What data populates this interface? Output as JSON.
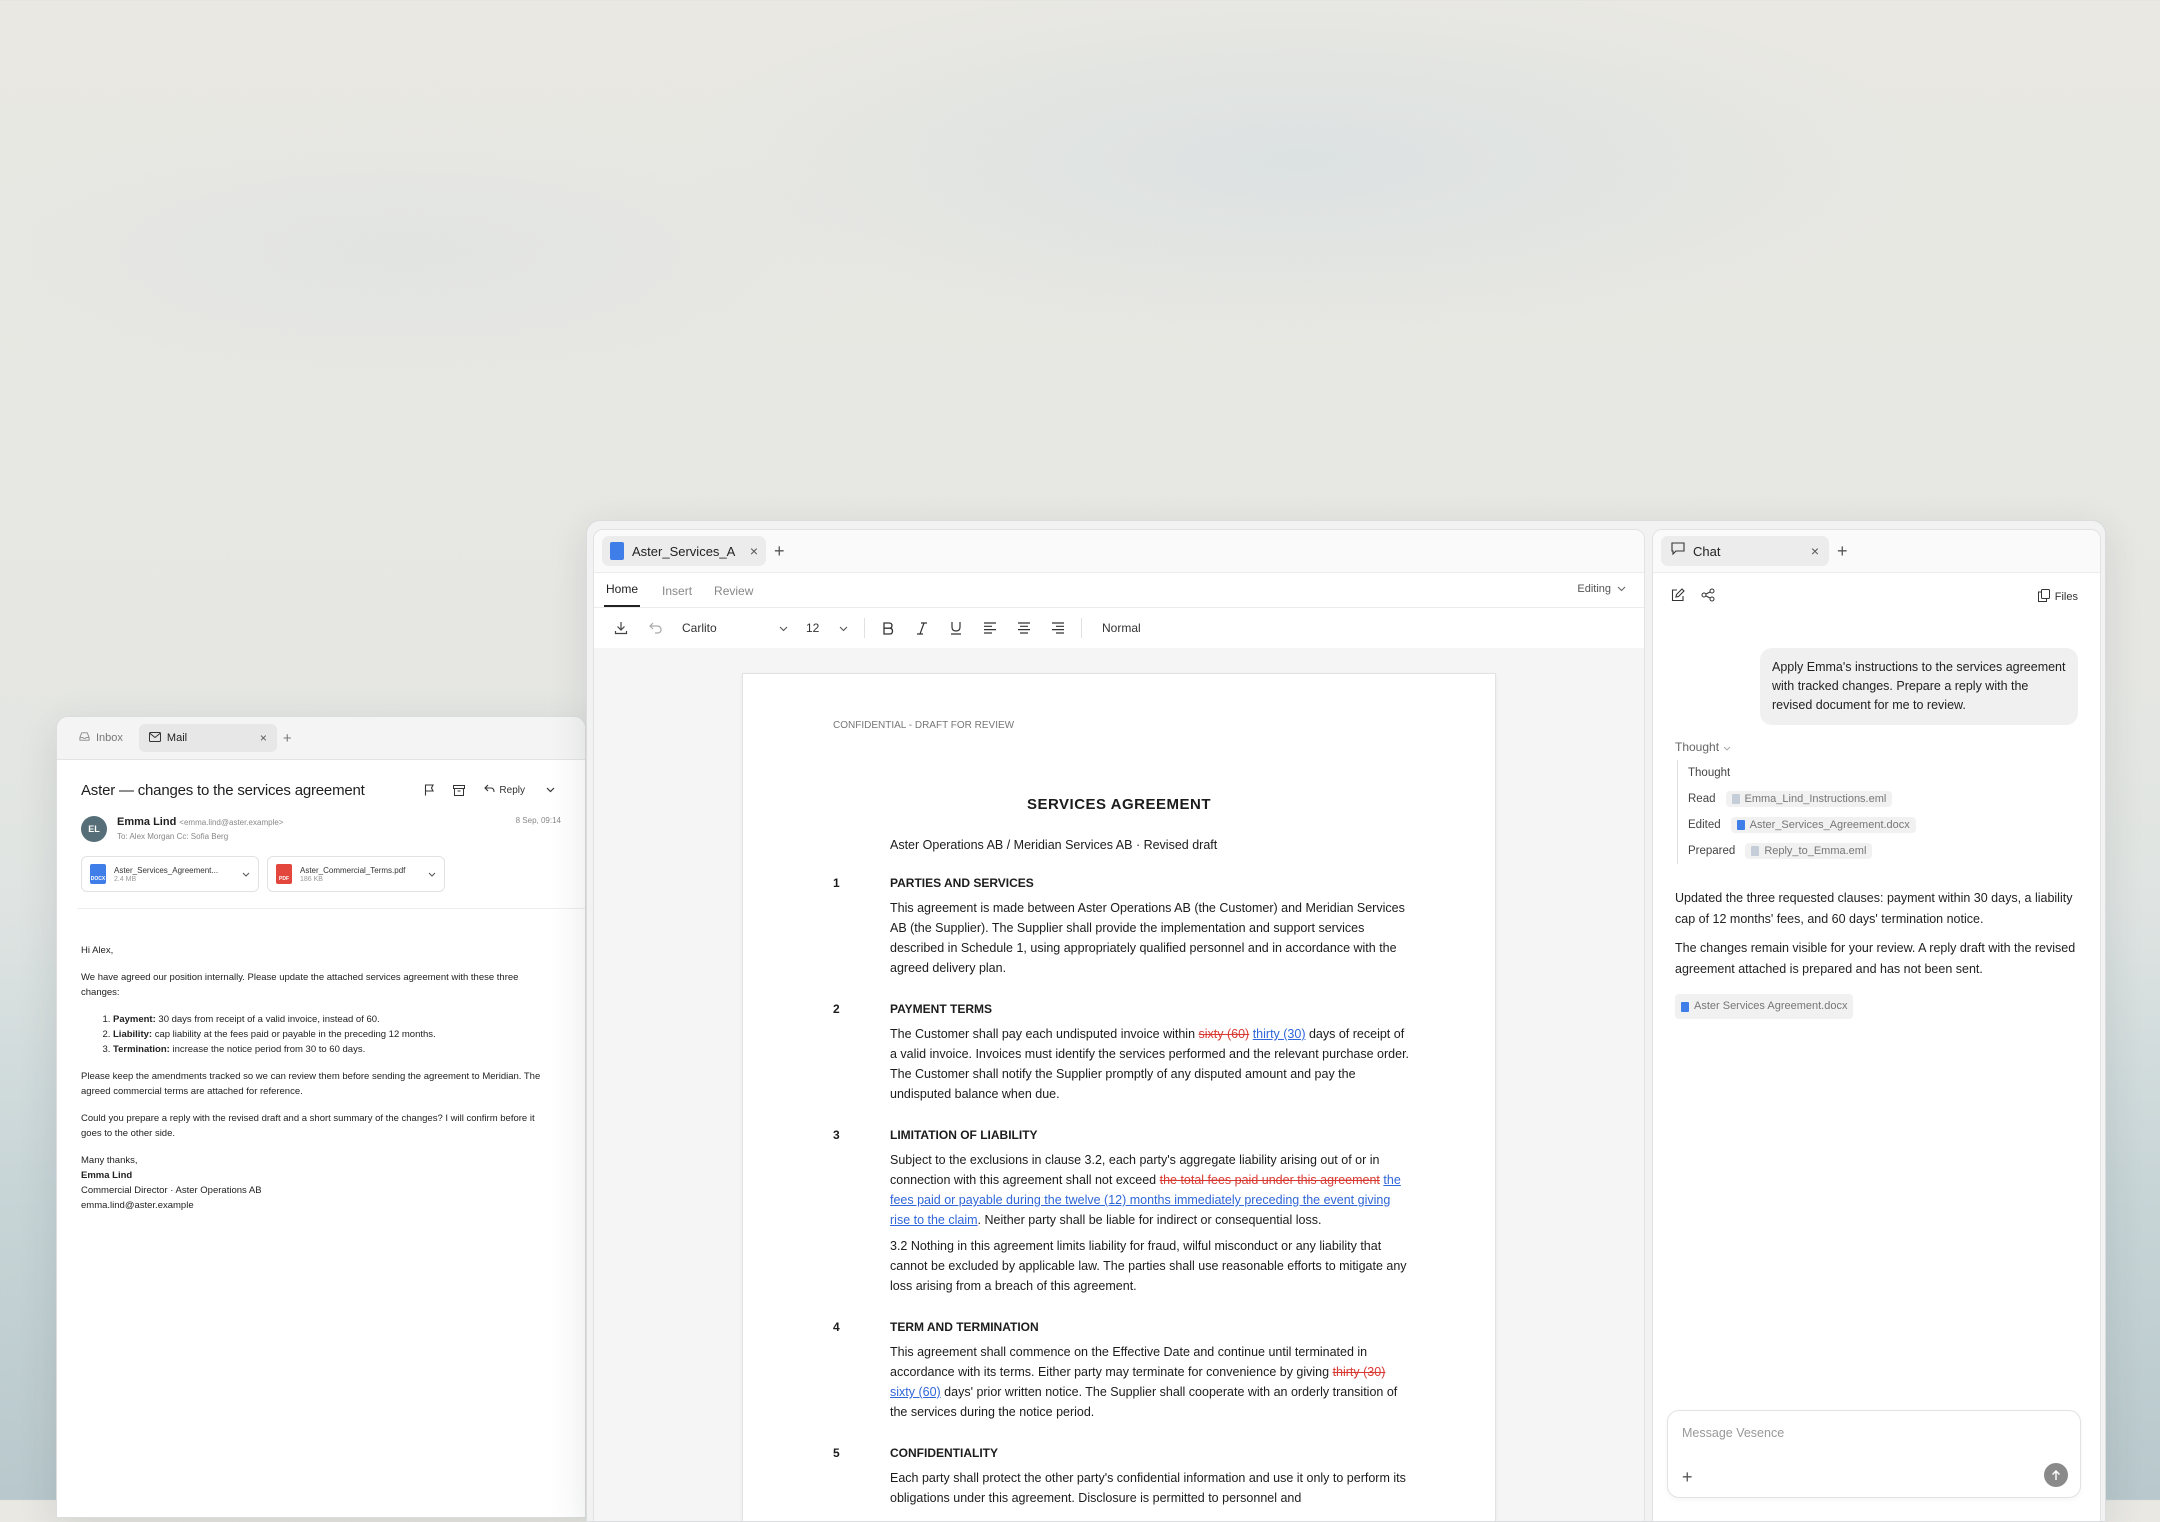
{
  "mail": {
    "tabs": [
      {
        "label": "Inbox"
      },
      {
        "label": "Mail"
      }
    ],
    "subject": "Aster — changes to the services agreement",
    "reply_label": "Reply",
    "avatar_initials": "EL",
    "sender_name": "Emma Lind",
    "sender_email": "<emma.lind@aster.example>",
    "to_line": "To: Alex Morgan   Cc: Sofia Berg",
    "date": "8 Sep, 09:14",
    "attachments": [
      {
        "name": "Aster_Services_Agreement...",
        "size": "2.4 MB",
        "type": "DOCX"
      },
      {
        "name": "Aster_Commercial_Terms.pdf",
        "size": "186 KB",
        "type": "PDF"
      }
    ],
    "greeting": "Hi Alex,",
    "para1": "We have agreed our position internally. Please update the attached services agreement with these three changes:",
    "list": [
      {
        "label": "Payment:",
        "text": "30 days from receipt of a valid invoice, instead of 60."
      },
      {
        "label": "Liability:",
        "text": "cap liability at the fees paid or payable in the preceding 12 months."
      },
      {
        "label": "Termination:",
        "text": "increase the notice period from 30 to 60 days."
      }
    ],
    "para2": "Please keep the amendments tracked so we can review them before sending the agreement to Meridian. The agreed commercial terms are attached for reference.",
    "para3": "Could you prepare a reply with the revised draft and a short summary of the changes? I will confirm before it goes to the other side.",
    "sign_off": "Many thanks,",
    "sig_name": "Emma Lind",
    "sig_title": "Commercial Director · Aster Operations AB",
    "sig_email": "emma.lind@aster.example"
  },
  "doc": {
    "tab_label": "Aster_Services_A",
    "ribbon_tabs": [
      "Home",
      "Insert",
      "Review"
    ],
    "mode": "Editing",
    "font": "Carlito",
    "size": "12",
    "style": "Normal",
    "header": "CONFIDENTIAL - DRAFT FOR REVIEW",
    "title": "SERVICES AGREEMENT",
    "subtitle": "Aster Operations AB / Meridian Services AB · Revised draft",
    "clauses": [
      {
        "num": "1",
        "heading": "PARTIES AND SERVICES",
        "body": "This agreement is made between Aster Operations AB (the Customer) and Meridian Services AB (the Supplier). The Supplier shall provide the implementation and support services described in Schedule 1, using appropriately qualified personnel and in accordance with the agreed delivery plan."
      },
      {
        "num": "2",
        "heading": "PAYMENT TERMS",
        "pre": "The Customer shall pay each undisputed invoice within ",
        "del": "sixty (60)",
        "ins": "thirty (30)",
        "post": " days of receipt of a valid invoice. Invoices must identify the services performed and the relevant purchase order. The Customer shall notify the Supplier promptly of any disputed amount and pay the undisputed balance when due."
      },
      {
        "num": "3",
        "heading": "LIMITATION OF LIABILITY",
        "pre": "Subject to the exclusions in clause 3.2, each party's aggregate liability arising out of or in connection with this agreement shall not exceed ",
        "del": "the total fees paid under this agreement",
        "ins": "the fees paid or payable during the twelve (12) months immediately preceding the event giving rise to the claim",
        "post": ". Neither party shall be liable for indirect or consequential loss.",
        "extra": "3.2 Nothing in this agreement limits liability for fraud, wilful misconduct or any liability that cannot be excluded by applicable law. The parties shall use reasonable efforts to mitigate any loss arising from a breach of this agreement."
      },
      {
        "num": "4",
        "heading": "TERM AND TERMINATION",
        "pre": "This agreement shall commence on the Effective Date and continue until terminated in accordance with its terms. Either party may terminate for convenience by giving ",
        "del": "thirty (30)",
        "ins": "sixty (60)",
        "post": " days' prior written notice. The Supplier shall cooperate with an orderly transition of the services during the notice period."
      },
      {
        "num": "5",
        "heading": "CONFIDENTIALITY",
        "body": "Each party shall protect the other party's confidential information and use it only to perform its obligations under this agreement. Disclosure is permitted to personnel and"
      }
    ]
  },
  "chat": {
    "tab_label": "Chat",
    "files_label": "Files",
    "user_message": "Apply Emma's instructions to the services agreement with tracked changes. Prepare a reply with the revised document for me to review.",
    "thought_label": "Thought",
    "steps": [
      {
        "label": "Thought",
        "file": ""
      },
      {
        "label": "Read",
        "file": "Emma_Lind_Instructions.eml"
      },
      {
        "label": "Edited",
        "file": "Aster_Services_Agreement.docx"
      },
      {
        "label": "Prepared",
        "file": "Reply_to_Emma.eml"
      }
    ],
    "reply_p1": "Updated the three requested clauses: payment within 30 days, a liability cap of 12 months' fees, and 60 days' termination notice.",
    "reply_p2": "The changes remain visible for your review. A reply draft with the revised agreement attached is prepared and has not been sent.",
    "attachment_chip": "Aster Services Agreement.docx",
    "input_placeholder": "Message Vesence"
  }
}
